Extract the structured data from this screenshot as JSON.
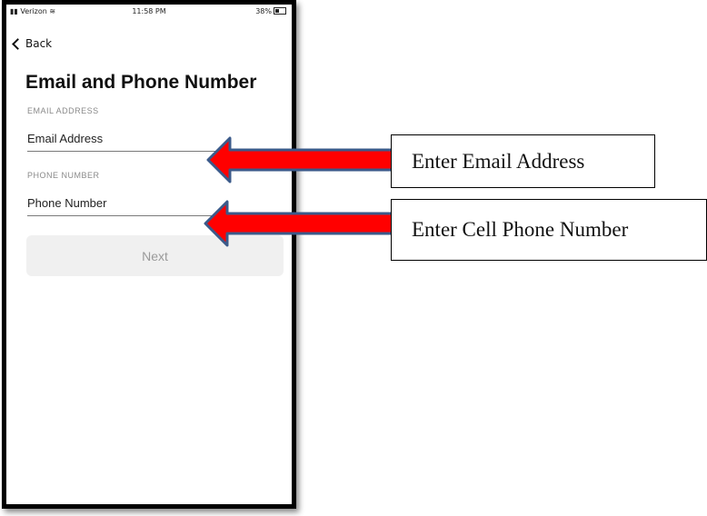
{
  "status_bar": {
    "carrier": "Verizon",
    "time": "11:58 PM",
    "battery": "38%"
  },
  "nav": {
    "back_label": "Back"
  },
  "page": {
    "title": "Email and Phone Number"
  },
  "form": {
    "email": {
      "caption": "EMAIL ADDRESS",
      "placeholder": "Email Address"
    },
    "phone": {
      "caption": "PHONE NUMBER",
      "placeholder": "Phone Number"
    },
    "next_label": "Next"
  },
  "annotations": {
    "email_callout": "Enter Email Address",
    "phone_callout": "Enter Cell Phone Number",
    "arrow_fill_color": "#ff0000",
    "arrow_border_color": "#3b5a8a"
  }
}
